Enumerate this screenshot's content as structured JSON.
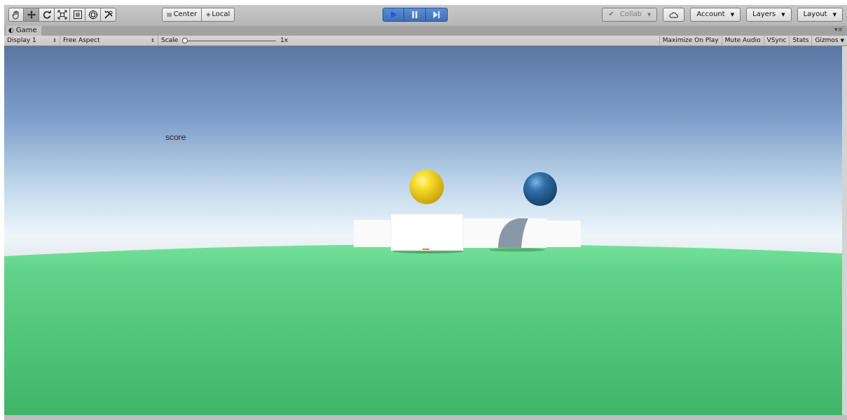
{
  "toolbar": {
    "tools": [
      {
        "name": "hand-tool",
        "icon": "hand-icon"
      },
      {
        "name": "move-tool",
        "icon": "move-icon"
      },
      {
        "name": "rotate-tool",
        "icon": "rotate-icon"
      },
      {
        "name": "scale-tool",
        "icon": "scale-icon"
      },
      {
        "name": "rect-tool",
        "icon": "rect-icon"
      },
      {
        "name": "transform-tool",
        "icon": "transform-icon"
      },
      {
        "name": "custom-tool",
        "icon": "tools-icon"
      }
    ],
    "pivot_label": "Center",
    "space_label": "Local",
    "collab_label": "Collab",
    "account_label": "Account",
    "layers_label": "Layers",
    "layout_label": "Layout"
  },
  "tab": {
    "label": "Game"
  },
  "game_toolbar": {
    "display": "Display 1",
    "aspect": "Free Aspect",
    "scale_label": "Scale",
    "scale_value": "1x",
    "maximize_on_play": "Maximize On Play",
    "mute_audio": "Mute Audio",
    "vsync": "VSync",
    "stats": "Stats",
    "gizmos": "Gizmos"
  },
  "scene": {
    "score_text": "score",
    "colors": {
      "sky_top": "#5a7aa6",
      "horizon": "#eef6fb",
      "ground": "#4fc27a",
      "yellow_ball": "#f5d21e",
      "blue_ball": "#2c6aa0"
    }
  },
  "colors": {
    "play_accent": "#4a7cc7",
    "editor_bg": "#c2c2c2"
  }
}
